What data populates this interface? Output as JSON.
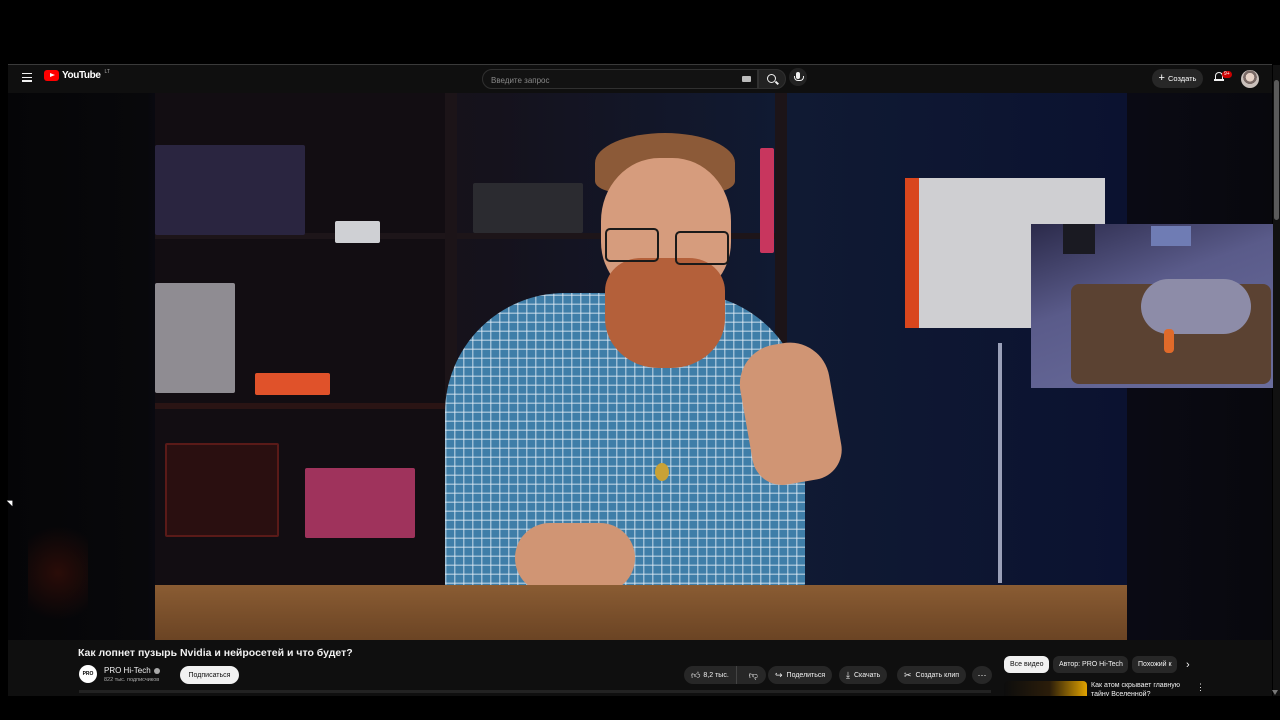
{
  "masthead": {
    "logo_text": "YouTube",
    "logo_country": "LT",
    "search_placeholder": "Введите запрос",
    "create_label": "Создать",
    "notifications_badge": "9+"
  },
  "video": {
    "title": "Как лопнет пузырь Nvidia и нейросетей и что будет?",
    "channel": {
      "name": "PRO Hi-Tech",
      "avatar_text": "PRO",
      "subscribers": "822 тыс. подписчиков",
      "subscribe_label": "Подписаться"
    },
    "actions": {
      "likes": "8,2 тыс.",
      "share": "Поделиться",
      "download": "Скачать",
      "clip": "Создать клип",
      "more": "⋯"
    }
  },
  "recommendations": {
    "chips": [
      "Все видео",
      "Автор: PRO Hi-Tech",
      "Похожий к"
    ],
    "first_item_title": "Как атом скрывает главную тайну Вселенной?"
  },
  "icons": {
    "menu": "menu-icon",
    "search": "search-icon",
    "mic": "mic-icon",
    "bell": "bell-icon",
    "like": "thumbs-up-icon",
    "dislike": "thumbs-down-icon",
    "share": "share-icon",
    "download": "download-icon",
    "clip": "scissors-icon"
  },
  "colors": {
    "brand": "#ff0000",
    "background": "#0f0f0f",
    "chip_active": "#f1f1f1"
  }
}
